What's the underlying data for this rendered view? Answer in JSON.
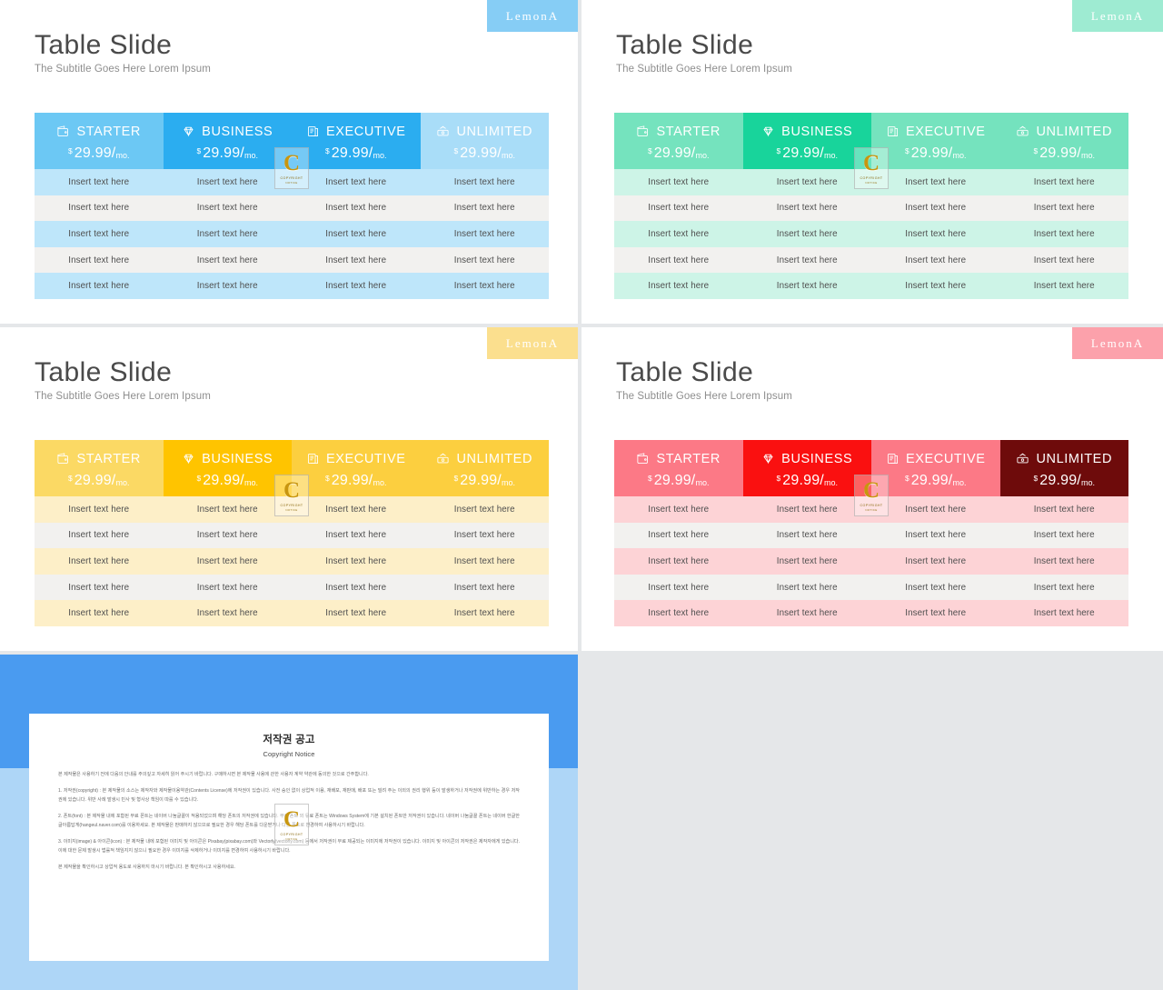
{
  "page": {
    "background_color": "#e5e7e9"
  },
  "slides": [
    {
      "id": "blue",
      "badge_label": "LemonA",
      "title": "Table Slide",
      "subtitle": "The Subtitle Goes Here Lorem Ipsum",
      "colors": {
        "badge_bg": "#86CDF5",
        "header_light": "#6CC8F4",
        "header_accent": "#2BADF0",
        "header_pale": "#A9DDF8",
        "row_tint": "#BEE6FA",
        "row_alt": "#F2F1EF"
      },
      "columns": [
        {
          "icon": "wallet-icon",
          "label": "STARTER",
          "currency": "$",
          "amount": "29.99/",
          "period": "mo.",
          "header_style": "light"
        },
        {
          "icon": "diamond-icon",
          "label": "BUSINESS",
          "currency": "$",
          "amount": "29.99/",
          "period": "mo.",
          "header_style": "accent"
        },
        {
          "icon": "document-icon",
          "label": "EXECUTIVE",
          "currency": "$",
          "amount": "29.99/",
          "period": "mo.",
          "header_style": "accent"
        },
        {
          "icon": "cash-icon",
          "label": "UNLIMITED",
          "currency": "$",
          "amount": "29.99/",
          "period": "mo.",
          "header_style": "pale"
        }
      ],
      "rows": [
        [
          "Insert text here",
          "Insert text here",
          "Insert text here",
          "Insert text here"
        ],
        [
          "Insert text here",
          "Insert text here",
          "Insert text here",
          "Insert text here"
        ],
        [
          "Insert text here",
          "Insert text here",
          "Insert text here",
          "Insert text here"
        ],
        [
          "Insert text here",
          "Insert text here",
          "Insert text here",
          "Insert text here"
        ],
        [
          "Insert text here",
          "Insert text here",
          "Insert text here",
          "Insert text here"
        ]
      ]
    },
    {
      "id": "green",
      "badge_label": "LemonA",
      "title": "Table Slide",
      "subtitle": "The Subtitle Goes Here Lorem Ipsum",
      "colors": {
        "badge_bg": "#9EEBD2",
        "header_light": "#75E3BE",
        "header_accent": "#18D49B",
        "header_pale": "#74E2BE",
        "row_tint": "#CDF4E7",
        "row_alt": "#F2F1EF"
      },
      "columns": [
        {
          "icon": "wallet-icon",
          "label": "STARTER",
          "currency": "$",
          "amount": "29.99/",
          "period": "mo.",
          "header_style": "light"
        },
        {
          "icon": "diamond-icon",
          "label": "BUSINESS",
          "currency": "$",
          "amount": "29.99/",
          "period": "mo.",
          "header_style": "accent"
        },
        {
          "icon": "document-icon",
          "label": "EXECUTIVE",
          "currency": "$",
          "amount": "29.99/",
          "period": "mo.",
          "header_style": "light"
        },
        {
          "icon": "cash-icon",
          "label": "UNLIMITED",
          "currency": "$",
          "amount": "29.99/",
          "period": "mo.",
          "header_style": "pale"
        }
      ],
      "rows": [
        [
          "Insert text here",
          "Insert text here",
          "Insert text here",
          "Insert text here"
        ],
        [
          "Insert text here",
          "Insert text here",
          "Insert text here",
          "Insert text here"
        ],
        [
          "Insert text here",
          "Insert text here",
          "Insert text here",
          "Insert text here"
        ],
        [
          "Insert text here",
          "Insert text here",
          "Insert text here",
          "Insert text here"
        ],
        [
          "Insert text here",
          "Insert text here",
          "Insert text here",
          "Insert text here"
        ]
      ]
    },
    {
      "id": "yellow",
      "badge_label": "LemonA",
      "title": "Table Slide",
      "subtitle": "The Subtitle Goes Here Lorem Ipsum",
      "colors": {
        "badge_bg": "#FBDF8E",
        "header_light": "#FBD964",
        "header_accent": "#FFC400",
        "header_pale": "#FCCF3F",
        "row_tint": "#FDEFC8",
        "row_alt": "#F2F1EF"
      },
      "columns": [
        {
          "icon": "wallet-icon",
          "label": "STARTER",
          "currency": "$",
          "amount": "29.99/",
          "period": "mo.",
          "header_style": "light"
        },
        {
          "icon": "diamond-icon",
          "label": "BUSINESS",
          "currency": "$",
          "amount": "29.99/",
          "period": "mo.",
          "header_style": "accent"
        },
        {
          "icon": "document-icon",
          "label": "EXECUTIVE",
          "currency": "$",
          "amount": "29.99/",
          "period": "mo.",
          "header_style": "pale"
        },
        {
          "icon": "cash-icon",
          "label": "UNLIMITED",
          "currency": "$",
          "amount": "29.99/",
          "period": "mo.",
          "header_style": "pale"
        }
      ],
      "rows": [
        [
          "Insert text here",
          "Insert text here",
          "Insert text here",
          "Insert text here"
        ],
        [
          "Insert text here",
          "Insert text here",
          "Insert text here",
          "Insert text here"
        ],
        [
          "Insert text here",
          "Insert text here",
          "Insert text here",
          "Insert text here"
        ],
        [
          "Insert text here",
          "Insert text here",
          "Insert text here",
          "Insert text here"
        ],
        [
          "Insert text here",
          "Insert text here",
          "Insert text here",
          "Insert text here"
        ]
      ]
    },
    {
      "id": "red",
      "badge_label": "LemonA",
      "title": "Table Slide",
      "subtitle": "The Subtitle Goes Here Lorem Ipsum",
      "colors": {
        "badge_bg": "#FCA1AB",
        "header_light": "#FC7986",
        "header_accent": "#FA1010",
        "header_pale": "#6E0B0B",
        "row_tint": "#FDD3D6",
        "row_alt": "#F2F1EF"
      },
      "columns": [
        {
          "icon": "wallet-icon",
          "label": "STARTER",
          "currency": "$",
          "amount": "29.99/",
          "period": "mo.",
          "header_style": "light"
        },
        {
          "icon": "diamond-icon",
          "label": "BUSINESS",
          "currency": "$",
          "amount": "29.99/",
          "period": "mo.",
          "header_style": "accent"
        },
        {
          "icon": "document-icon",
          "label": "EXECUTIVE",
          "currency": "$",
          "amount": "29.99/",
          "period": "mo.",
          "header_style": "light"
        },
        {
          "icon": "cash-icon",
          "label": "UNLIMITED",
          "currency": "$",
          "amount": "29.99/",
          "period": "mo.",
          "header_style": "pale"
        }
      ],
      "rows": [
        [
          "Insert text here",
          "Insert text here",
          "Insert text here",
          "Insert text here"
        ],
        [
          "Insert text here",
          "Insert text here",
          "Insert text here",
          "Insert text here"
        ],
        [
          "Insert text here",
          "Insert text here",
          "Insert text here",
          "Insert text here"
        ],
        [
          "Insert text here",
          "Insert text here",
          "Insert text here",
          "Insert text here"
        ],
        [
          "Insert text here",
          "Insert text here",
          "Insert text here",
          "Insert text here"
        ]
      ]
    }
  ],
  "watermark": {
    "letter": "C",
    "line1": "COPYRIGHT",
    "line2": "NOTICE"
  },
  "copyright_panel": {
    "frame_color_top": "#4A9BF0",
    "frame_color_bottom": "#AED6F7",
    "title": "저작권 공고",
    "subtitle": "Copyright Notice",
    "paragraphs": [
      "본 제작물은 사용하기 전에 다음의 안내를 주의깊고 자세히 읽어 주시기 바랍니다. 구매하시면 본 제작물 사용에 관한 사용자 계약 약관에 동의한 것으로 간주합니다.",
      "1. 저작권(copyright) : 본 제작물의 소스는 제작자와 제작물이용약관(Contents License)에 저작권이 있습니다. 사전 승인 없이 상업적 이용, 재배포, 재판매, 배포 또는 빌려 주는 이외의 권리 행위 등이 발생하거나 저작권에 위반하는 경우 저작권에 있습니다. 위반 사례 발생시 민사 및 형사상 책임이 따를 수 있습니다.",
      "2. 폰트(font) : 본 제작물 내에 포함된 무료 폰트는 네이버 나눔글꼴이 적용되었으며 해당 폰트의 저작권에 있습니다. 무료 폰트 외 유료 폰트는 Windows System에 기본 설치된 폰트만 저작권이 있습니다. 네이버 나눔글꼴 폰트는 네이버 한글한글아름답게(hangeul.naver.com)를 이용하세요. 본 제작물은 판매하지 않으므로 필요한 경우 해당 폰트를 다운받거나 다른 폰트로 변경하여 사용하시기 바랍니다.",
      "3. 이미지(image) & 아이콘(icon) : 본 제작물 내에 포함된 이미지 및 아이콘은 Pixabay(pixabay.com)와 Vectorly(vectorly.com) 등에서 저작권이 무료 제공되는 이미지에 저작권이 있습니다. 이미지 및 아이콘의 저작권은 제작자에게 있습니다. 이에 대한 문제 발생시 법률적 책임지지 않으니 필요한 경우 이미지를 삭제하거나 이미지를 변경하여 사용하시기 바랍니다.",
      "본 제작물을 확인하시고 상업적 용도로 사용하지 마시기 바랍니다. 본 확인하시고 사용하세요."
    ]
  }
}
